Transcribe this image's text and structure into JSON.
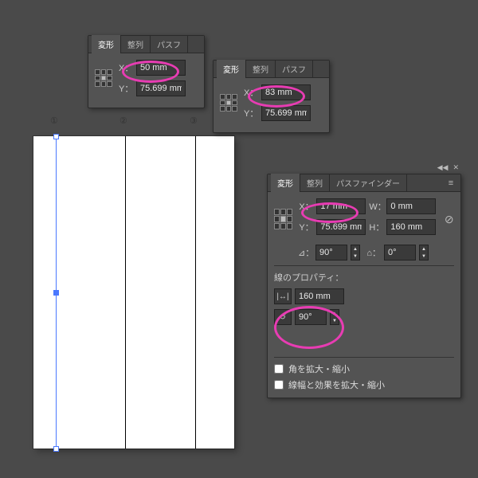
{
  "labels": {
    "num1": "①",
    "num2": "②",
    "num3": "③"
  },
  "small_panel": {
    "tabs": {
      "transform": "変形",
      "align": "整列",
      "pathf": "パスフ"
    },
    "x_label": "X：",
    "y_label": "Y："
  },
  "sp1": {
    "x": "50 mm",
    "y": "75.699 mm"
  },
  "sp2": {
    "x": "83 mm",
    "y": "75.699 mm"
  },
  "large_panel": {
    "tabs": {
      "transform": "変形",
      "align": "整列",
      "pathfinder": "パスファインダー"
    },
    "x_label": "X：",
    "y_label": "Y：",
    "w_label": "W：",
    "h_label": "H：",
    "x": "17 mm",
    "y": "75.699 mm",
    "w": "0 mm",
    "h": "160 mm",
    "rotate_label": "⊿：",
    "rotate": "90°",
    "shear_label": "⌂：",
    "shear": "0°",
    "line_props_head": "線のプロパティ：",
    "line_len": "160 mm",
    "line_angle": "90°",
    "scale_corners": "角を拡大・縮小",
    "scale_strokes": "線幅と効果を拡大・縮小"
  },
  "icons": {
    "menu": "≡",
    "collapse": "◀◀",
    "close": "✕",
    "length": "|↔|",
    "rotate": "↺",
    "link": "⊘",
    "tri_up": "▲",
    "tri_dn": "▼"
  }
}
